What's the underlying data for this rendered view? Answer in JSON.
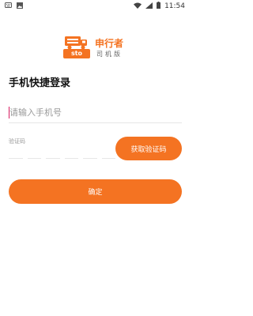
{
  "status_bar": {
    "time": "11:54",
    "icons": [
      "keyboard-icon",
      "image-icon",
      "wifi-icon",
      "signal-icon",
      "battery-icon"
    ]
  },
  "logo": {
    "badge_text": "sto",
    "brand_name": "申行者",
    "subtitle": "司机版"
  },
  "page_title": "手机快捷登录",
  "phone": {
    "placeholder": "请输入手机号",
    "value": ""
  },
  "verification": {
    "label": "验证码",
    "value": "",
    "get_code_label": "获取验证码"
  },
  "confirm_label": "确定",
  "colors": {
    "accent": "#f47322",
    "caret": "#d81b60"
  }
}
